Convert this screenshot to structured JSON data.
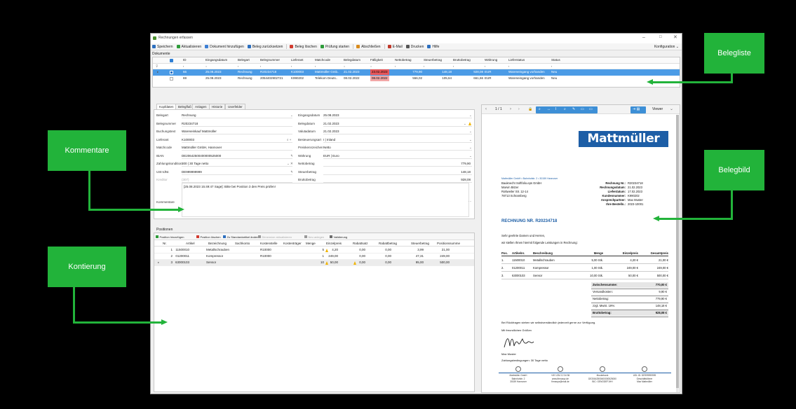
{
  "window": {
    "title": "Rechnungen erfassen",
    "configuration": "Konfiguration ⌄"
  },
  "toolbar": [
    "Speichern",
    "Aktualisieren",
    "Dokument hinzufügen",
    "Beleg zurücksetzen",
    "Beleg löschen",
    "Prüfung starten",
    "Abschließen",
    "E-Mail",
    "Drucken",
    "Hilfe"
  ],
  "documents": {
    "section": "Dokumente",
    "columns": [
      "ID",
      "Eingangsdatum",
      "Belegart",
      "Belegnummer",
      "Lieferant",
      "Matchcode",
      "Belegdatum",
      "Fälligkeit",
      "Nettobetrag",
      "Steuerbetrag",
      "Bruttobetrag",
      "Währung",
      "Lieferstatus",
      "Status"
    ],
    "rows": [
      [
        "66",
        "25.08.2023",
        "Rechnung",
        "R20234718",
        "K100003",
        "Mattmüller Gmb..",
        "21.02.2023",
        "23.02.2023",
        "779,90",
        "148,18",
        "928,08",
        "EUR",
        "Wareneingang vorhanden",
        "Neu"
      ],
      [
        "69",
        "25.08.2023",
        "Rechnung",
        "2054402902721",
        "K990202",
        "Telekom Deuts..",
        "08.02.2022",
        "08.02.2022",
        "556,02",
        "105,64",
        "661,66",
        "EUR",
        "Wareneingang vorhanden",
        "Neu"
      ]
    ]
  },
  "tabs": [
    "Kopfdaten",
    "Belegfluß",
    "Anlagen",
    "Historie",
    "Userfelder"
  ],
  "head_left": [
    {
      "label": "Belegart",
      "value": "Rechnung"
    },
    {
      "label": "Belegnummer",
      "value": "R20234718"
    },
    {
      "label": "Buchungstext",
      "value": "Wareneinkauf Mattmüller"
    },
    {
      "label": "Lieferant",
      "value": "K100003"
    },
    {
      "label": "Matchcode",
      "value": "Mattmüller GmbH, Hannover"
    },
    {
      "label": "IBAN",
      "value": "DE20642500400000525000"
    },
    {
      "label": "Zahlungskondition",
      "value": "300 | 30 Tage netto"
    },
    {
      "label": "USt-IdNr.",
      "value": "DE999999999"
    },
    {
      "label": "Kreditor",
      "value": "(307)"
    }
  ],
  "head_right": [
    {
      "label": "Eingangsdatum",
      "value": "25.08.2023"
    },
    {
      "label": "Belegdatum",
      "value": "21.02.2023"
    },
    {
      "label": "Valutadatum",
      "value": "21.02.2023"
    },
    {
      "label": "Besteuerungsart",
      "value": "I | Inland"
    },
    {
      "label": "Preiskennzeichen",
      "value": "Netto"
    },
    {
      "label": "Währung",
      "value": "EUR | Euro"
    },
    {
      "label": "Nettobetrag",
      "value": "779,90"
    },
    {
      "label": "Steuerbetrag",
      "value": "148,18"
    },
    {
      "label": "Bruttobetrag",
      "value": "928,08"
    }
  ],
  "comment": {
    "label": "Kommentare",
    "text": "[25.08.2023 15:49:47 Sage]: Bitte bei Position 3 den Preis prüfen!"
  },
  "positions": {
    "section": "Positionen",
    "toolbar": [
      "Position hinzufügen",
      "Position löschen",
      "Zu Standardartikel ändern",
      "Dimension aktualisieren",
      "Neu anlegen",
      "Validierung"
    ],
    "columns": [
      "Nr.",
      "Artikel",
      "Bezeichnung",
      "Sachkonto",
      "Kostenstelle",
      "Kostenträger",
      "Menge",
      "Einzelpreis",
      "Rabattsatz",
      "Rabattbetrag",
      "Steuerbetrag",
      "Positionssumme"
    ],
    "rows": [
      [
        "1",
        "11500010",
        "Metallschrauben",
        "",
        "R10000",
        "",
        "5",
        "4,20",
        "0,00",
        "0,00",
        "3,99",
        "21,00"
      ],
      [
        "2",
        "01200011",
        "Kompressor",
        "",
        "R10000",
        "",
        "1",
        "249,00",
        "0,00",
        "0,00",
        "47,31",
        "249,00"
      ],
      [
        "3",
        "63000103",
        "Sensor",
        "",
        "",
        "",
        "10",
        "50,00",
        "0,00",
        "0,00",
        "95,00",
        "500,00"
      ]
    ]
  },
  "viewer": {
    "page": "1 / 1",
    "mode": "Viewer"
  },
  "invoice": {
    "logo": "Mattmüller",
    "sender_line": "Mattmüller GmbH • Bahnhofstr. 2 • 30159 Hannover",
    "recipient": [
      "Bauknecht Softfolio.eps GmbH",
      "Marvin Bitzer",
      "Rottweiler Str. 12-14",
      "78713 Schramberg"
    ],
    "meta": [
      [
        "Rechnung Nr.:",
        "R20234718"
      ],
      [
        "Rechnungsdatum:",
        "21.02.2023"
      ],
      [
        "Lieferdatum:",
        "17.02.2023"
      ],
      [
        "Kundennummer:",
        "K990202"
      ],
      [
        "Ansprechpartner:",
        "Max Muster"
      ],
      [
        "Ihre Bestelln.:",
        "2023-10001"
      ]
    ],
    "title": "RECHNUNG NR. R20234718",
    "greeting": "Sehr geehrte Damen und Herren,",
    "intro": "wir stellen Ihnen hiermit folgende Leistungen in Rechnung:",
    "columns": [
      "Pos.",
      "Artikelnr.",
      "Beschreibung",
      "Menge",
      "Einzelpreis",
      "Gesamtpreis"
    ],
    "rows": [
      [
        "1.",
        "11500010",
        "Metallschrauben",
        "5,00 Stk.",
        "4,20 €",
        "21,00 €"
      ],
      [
        "2.",
        "01200011",
        "Kompressor",
        "1,00 Stk.",
        "249,00 €",
        "249,00 €"
      ],
      [
        "3.",
        "63000103",
        "Sensor",
        "10,00 Stk.",
        "50,00 €",
        "500,00 €"
      ]
    ],
    "totals": [
      [
        "Zwischensumme:",
        "770,00 €"
      ],
      [
        "Versandkosten:",
        "9,90 €"
      ],
      [
        "Nettobetrag:",
        "779,90 €"
      ],
      [
        "zzgl. MwSt. 19%:",
        "148,18 €"
      ],
      [
        "Bruttobetrag:",
        "928,08 €"
      ]
    ],
    "closing1": "Bei Rückfragen stehen wir selbstverständlich jederzeit gerne zur Verfügung.",
    "closing2": "Mit freundlichen Grüßen",
    "signer": "Max Muster",
    "terms": "Zahlungsbedingungen: 30 Tage netto",
    "footer": [
      [
        "Mattmüller GmbH",
        "Bahnhofstr. 2",
        "30159 Hannover"
      ],
      [
        "+49 1234 12 34 56",
        "www.firmaxyz.de",
        "firmaxyz@mail.de"
      ],
      [
        "Musterbank",
        "DE20642500400000525000",
        "BIC: GENODEF1HH"
      ],
      [
        "USt.-ID: DE999999999",
        "Geschäftsführer",
        "Max Mattmüller"
      ]
    ]
  },
  "callouts": {
    "belegliste": "Belegliste",
    "kommentare": "Kommentare",
    "belegbild": "Belegbild",
    "kontierung": "Kontierung"
  }
}
